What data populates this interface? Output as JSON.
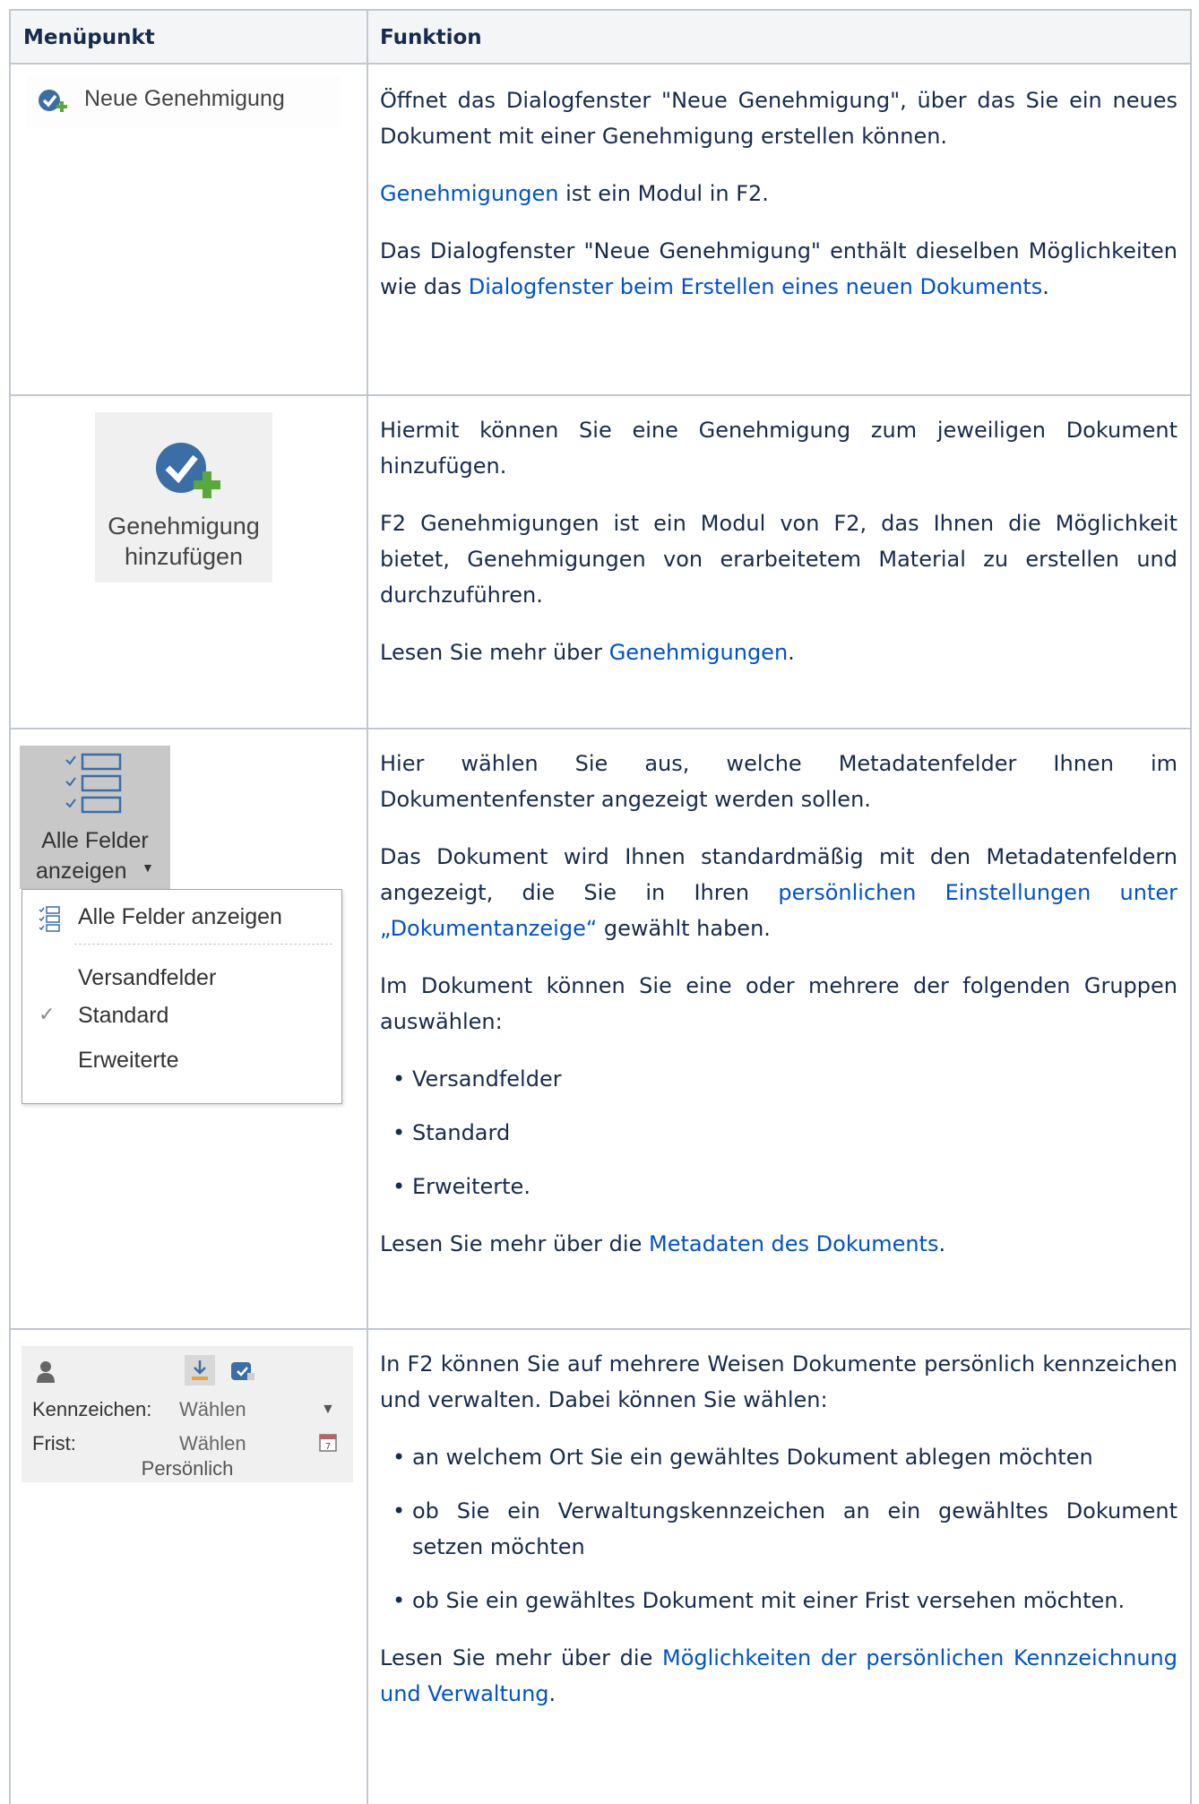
{
  "header": {
    "col1": "Menüpunkt",
    "col2": "Funktion"
  },
  "row1": {
    "icon_label": "Neue Genehmigung",
    "p1": "Öffnet das Dialogfenster \"Neue Genehmigung\", über das Sie ein neues Dokument mit einer Genehmigung erstellen können.",
    "p2_link": "Genehmigungen",
    "p2_rest": " ist ein Modul in F2.",
    "p3_pre": "Das Dialogfenster \"Neue Genehmigung\" enthält dieselben Möglichkeiten wie das ",
    "p3_link": "Dialogfenster beim Erstellen eines neuen Dokuments",
    "p3_post": "."
  },
  "row2": {
    "icon_label_1": "Genehmigung",
    "icon_label_2": "hinzufügen",
    "p1": "Hiermit können Sie eine Genehmigung zum jeweiligen Dokument hinzufügen.",
    "p2": "F2 Genehmigungen ist ein Modul von F2, das Ihnen die Möglichkeit bietet, Genehmigungen von erarbeitetem Material zu erstellen und durchzuführen.",
    "p3_pre": "Lesen Sie mehr über ",
    "p3_link": "Genehmigungen",
    "p3_post": "."
  },
  "row3": {
    "button_line1": "Alle Felder",
    "button_line2": "anzeigen",
    "menu_items": [
      "Alle Felder anzeigen",
      "Versandfelder",
      "Standard",
      "Erweiterte"
    ],
    "p1": "Hier wählen Sie aus, welche Metadatenfelder Ihnen im Dokumentenfenster angezeigt werden sollen.",
    "p2_pre": "Das Dokument wird Ihnen standardmäßig mit den Metadatenfeldern angezeigt, die Sie in Ihren ",
    "p2_link": "persönlichen Einstellungen unter „Dokumentanzeige“",
    "p2_post": " gewählt haben.",
    "p3": "Im Dokument können Sie eine oder mehrere der folgenden Gruppen auswählen:",
    "bullets": [
      "Versandfelder",
      "Standard",
      "Erweiterte."
    ],
    "p4_pre": "Lesen Sie mehr über die ",
    "p4_link": "Metadaten des Dokuments",
    "p4_post": "."
  },
  "row4": {
    "label_kennzeichen": "Kennzeichen:",
    "label_frist": "Frist:",
    "value_kennzeichen": "Wählen",
    "value_frist": "Wählen",
    "group_label": "Persönlich",
    "p1": "In F2 können Sie auf mehrere Weisen Dokumente persönlich kennzeichen und verwalten. Dabei können Sie wählen:",
    "bullets": [
      "an welchem Ort Sie ein gewähltes Dokument ablegen möchten",
      "ob Sie ein Verwaltungskennzeichen an ein gewähltes Dokument setzen möchten",
      "ob Sie ein gewähltes Dokument mit einer Frist versehen möchten."
    ],
    "p2_pre": "Lesen Sie mehr über die ",
    "p2_link": "Möglichkeiten der persönlichen Kennzeichnung und Verwaltung",
    "p2_post": "."
  },
  "colors": {
    "link": "#0052cc",
    "border": "#c1c7d0",
    "header_bg": "#f4f5f7",
    "icon_blue": "#3a6ea5",
    "plus_green": "#5aa83c"
  },
  "icons": [
    "approval-check-icon",
    "add-approval-icon",
    "fields-list-icon",
    "checkmark-icon",
    "person-icon",
    "download-icon",
    "approval-small-icon",
    "dropdown-arrow-icon",
    "calendar-icon"
  ]
}
